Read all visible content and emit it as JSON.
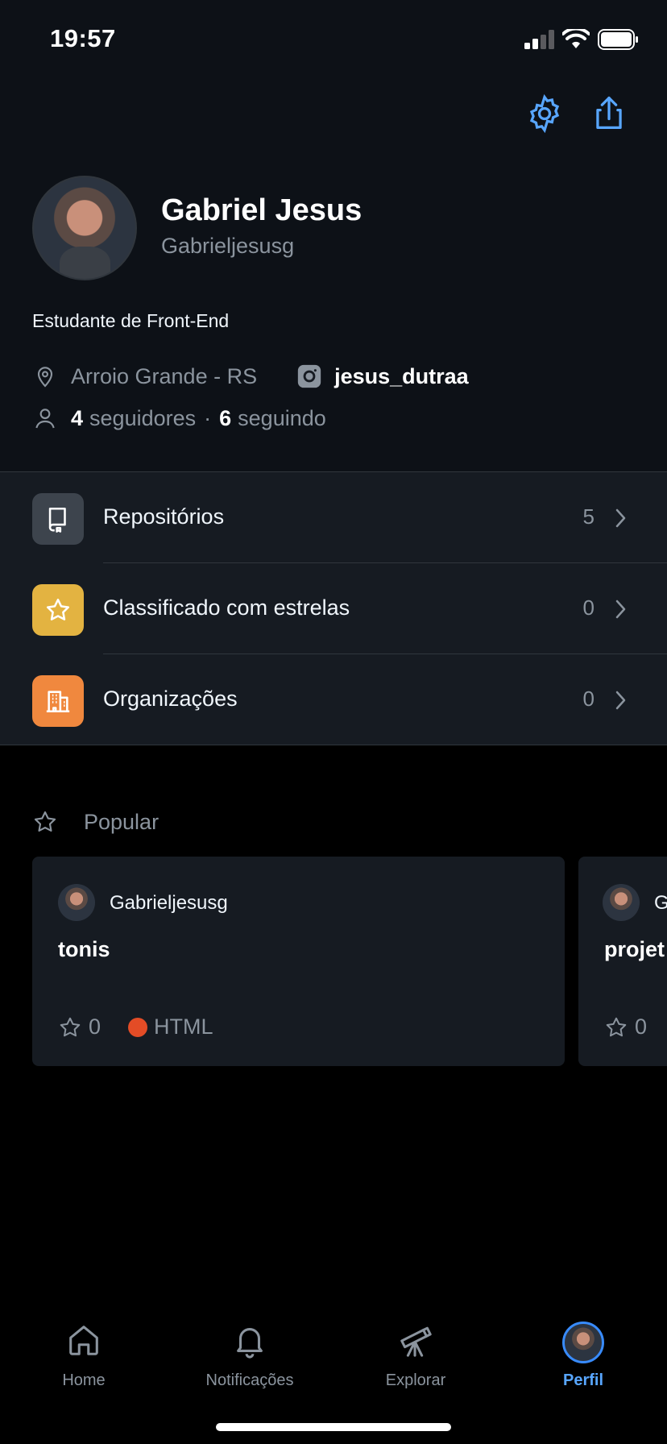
{
  "status_bar": {
    "time": "19:57"
  },
  "profile": {
    "name": "Gabriel Jesus",
    "login": "Gabrieljesusg",
    "bio": "Estudante de Front-End",
    "location": "Arroio Grande - RS",
    "instagram": "jesus_dutraa",
    "followers_count": "4",
    "followers_label": "seguidores",
    "separator": "·",
    "following_count": "6",
    "following_label": "seguindo"
  },
  "menu": {
    "items": [
      {
        "label": "Repositórios",
        "count": "5",
        "icon": "repo-icon",
        "color": "#3d444d"
      },
      {
        "label": "Classificado com estrelas",
        "count": "0",
        "icon": "star-icon",
        "color": "#e3b341"
      },
      {
        "label": "Organizações",
        "count": "0",
        "icon": "organization-icon",
        "color": "#f0883e"
      }
    ]
  },
  "popular": {
    "title": "Popular",
    "cards": [
      {
        "owner": "Gabrieljesusg",
        "repo": "tonis",
        "stars": "0",
        "language": "HTML",
        "language_color": "#e34c26"
      },
      {
        "owner": "Gabrieljesusg",
        "repo": "projet",
        "stars": "0"
      }
    ]
  },
  "tabbar": {
    "tabs": [
      {
        "label": "Home",
        "icon": "home-icon"
      },
      {
        "label": "Notificações",
        "icon": "bell-icon"
      },
      {
        "label": "Explorar",
        "icon": "telescope-icon"
      },
      {
        "label": "Perfil",
        "icon": "avatar"
      }
    ],
    "active": "Perfil"
  },
  "colors": {
    "accent": "#58a6ff",
    "background": "#000000",
    "surface": "#161b22"
  }
}
